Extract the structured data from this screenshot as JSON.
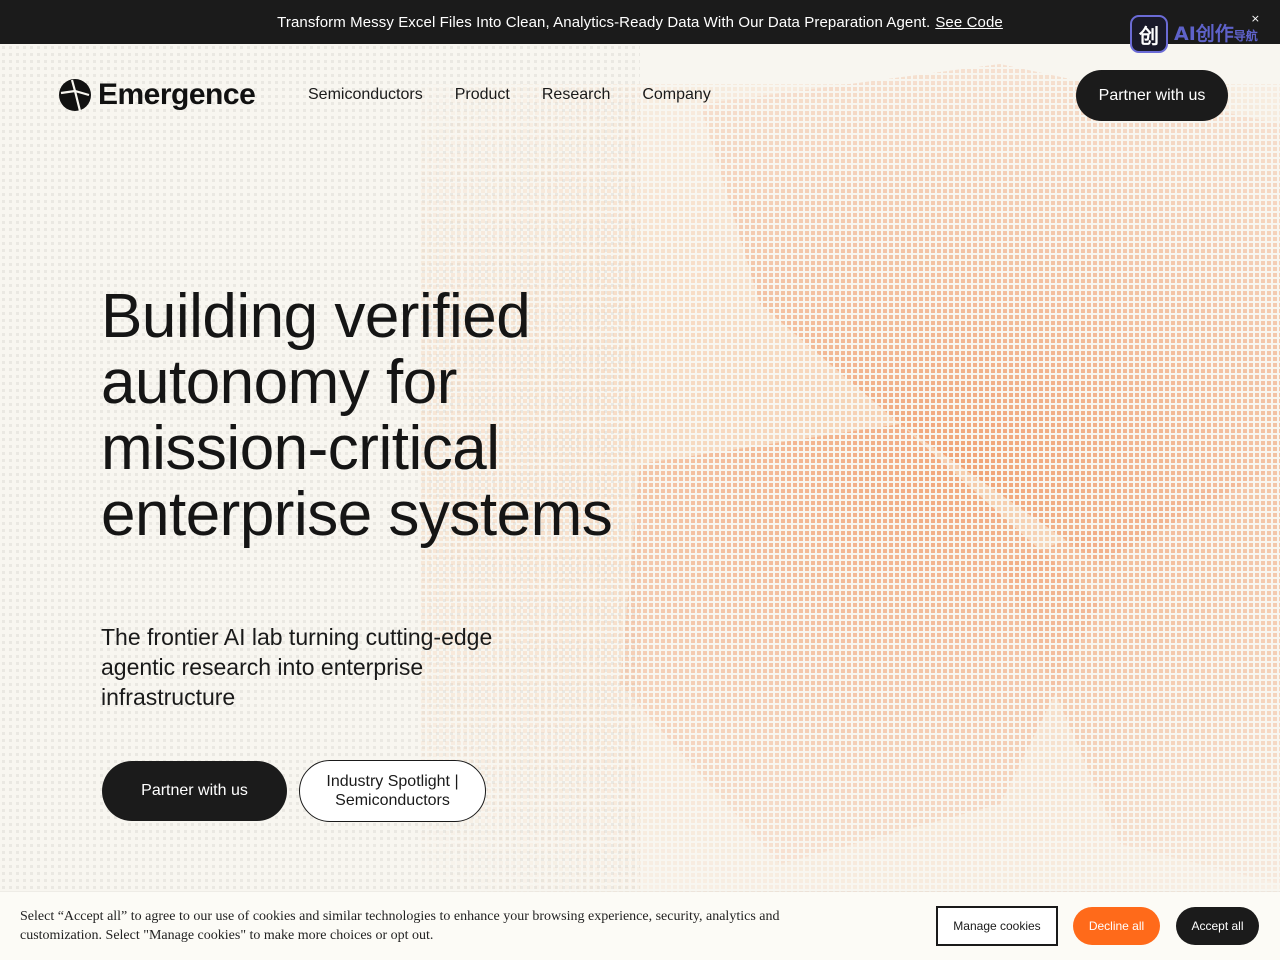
{
  "announcement": {
    "text": "Transform Messy Excel Files Into Clean, Analytics-Ready Data With Our Data Preparation Agent.",
    "link_label": "See Code"
  },
  "badge": {
    "logo_glyph": "创",
    "label": "AI创作",
    "sub": "导航",
    "close": "×"
  },
  "header": {
    "brand": "Emergence",
    "nav": [
      "Semiconductors",
      "Product",
      "Research",
      "Company"
    ],
    "cta": "Partner with us"
  },
  "hero": {
    "title_lines": [
      "Building verified",
      "autonomy for",
      "mission-critical",
      "enterprise systems"
    ],
    "subtitle_lines": [
      "The frontier AI lab turning cutting-edge",
      "agentic research into enterprise",
      "infrastructure"
    ],
    "primary_cta": "Partner with us",
    "secondary_cta_lines": [
      "Industry Spotlight |",
      "Semiconductors"
    ]
  },
  "cookie": {
    "line1": "Select “Accept all” to agree to our use of cookies and similar technologies to enhance your browsing experience, security, analytics and",
    "line2": "customization. Select \"Manage cookies\" to make more choices or opt out.",
    "manage": "Manage cookies",
    "decline": "Decline all",
    "accept": "Accept all"
  },
  "colors": {
    "dark": "#1b1b1b",
    "accent_orange": "#ff6a1a",
    "art_orange": "#f0a070",
    "background": "#f8f6f0"
  }
}
